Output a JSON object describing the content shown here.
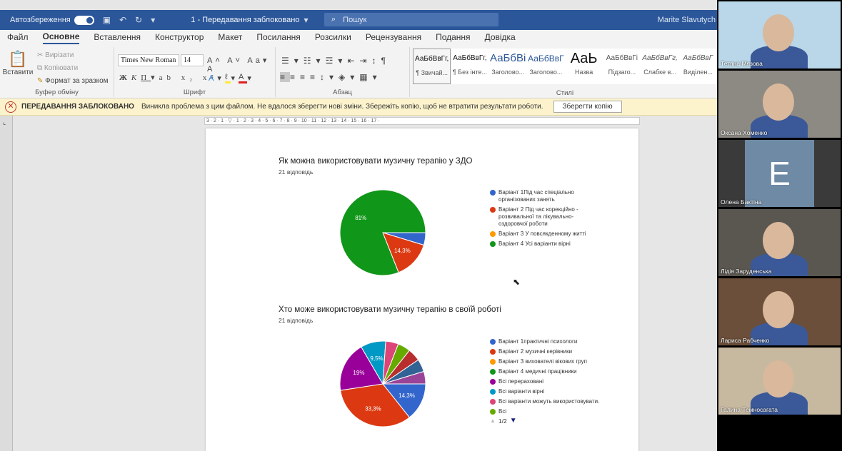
{
  "titlebar": {
    "autosave": "Автозбереження",
    "doc_title": "1 - Передавання заблоковано",
    "search_placeholder": "Пошук",
    "user": "Marite Slavutych"
  },
  "menu": [
    "Файл",
    "Основне",
    "Вставлення",
    "Конструктор",
    "Макет",
    "Посилання",
    "Розсилки",
    "Рецензування",
    "Подання",
    "Довідка"
  ],
  "ribbon": {
    "clipboard": {
      "paste": "Вставити",
      "cut": "Вирізати",
      "copy": "Копіювати",
      "format": "Формат за зразком",
      "label": "Буфер обміну"
    },
    "font": {
      "name": "Times New Roman",
      "size": "14",
      "label": "Шрифт"
    },
    "paragraph": {
      "label": "Абзац"
    },
    "styles": {
      "label": "Стилі",
      "items": [
        {
          "preview": "АаБбВвГг,",
          "name": "¶ Звичай..."
        },
        {
          "preview": "АаБбВвГг,",
          "name": "¶ Без інте..."
        },
        {
          "preview": "АаБбВі",
          "name": "Заголово..."
        },
        {
          "preview": "АаБбВвГ",
          "name": "Заголово..."
        },
        {
          "preview": "АаЬ",
          "name": "Назва"
        },
        {
          "preview": "АаБбВвГі",
          "name": "Підзаго..."
        },
        {
          "preview": "АаБбВвГг,",
          "name": "Слабке в..."
        },
        {
          "preview": "АаБбВвГ",
          "name": "Виділен..."
        }
      ]
    }
  },
  "banner": {
    "title": "ПЕРЕДАВАННЯ ЗАБЛОКОВАНО",
    "message": "Виникла проблема з цим файлом. Не вдалося зберегти нові зміни. Збережіть копію, щоб не втратити результати роботи.",
    "button": "Зберегти копію"
  },
  "chart_data": [
    {
      "type": "pie",
      "title": "Як можна використовувати музичну терапію у ЗДО",
      "subtitle": "21 відповідь",
      "labels": [
        "Варіант 1Під час спеціально організованих занять",
        "Варіант 2 Під час корекційно - розвивальної та лікувально-оздоровчої роботи",
        "Варіант 3 У повсякденному житті",
        "Варіант 4 Усі варіанти вірні"
      ],
      "values": [
        4.7,
        14.3,
        0,
        81
      ],
      "value_labels": [
        "",
        "14,3%",
        "",
        "81%"
      ],
      "colors": [
        "#3366cc",
        "#dc3912",
        "#ff9900",
        "#109618"
      ]
    },
    {
      "type": "pie",
      "title": "Хто може використовувати музичну терапію в своїй роботі",
      "subtitle": "21 відповідь",
      "labels": [
        "Варіант 1практичні психологи",
        "Варіант 2 музичні керівники",
        "Варіант 3 вихователі вікових груп",
        "Варіант 4 медичні працівники",
        "Всі перераховані",
        "Всі варіанти вірні",
        "Всі варіанти можуть використовувати.",
        "Всі"
      ],
      "values": [
        14.3,
        33.3,
        0,
        0,
        19,
        9.5,
        4.8,
        4.8,
        4.8,
        4.8
      ],
      "slice_colors": [
        "#3366cc",
        "#dc3912",
        "#990099",
        "#0099c6",
        "#dd4477",
        "#66aa00",
        "#b82e2e",
        "#316395",
        "#994499"
      ],
      "slice_values": [
        14.3,
        33.3,
        19,
        9.5,
        4.8,
        4.8,
        4.8,
        4.8,
        4.7
      ],
      "value_labels": [
        "14,3%",
        "33,3%",
        "19%",
        "9,5%",
        "",
        "",
        "",
        "",
        ""
      ],
      "legend_colors": [
        "#3366cc",
        "#dc3912",
        "#ff9900",
        "#109618",
        "#990099",
        "#0099c6",
        "#dd4477",
        "#66aa00"
      ],
      "pager": "1/2"
    }
  ],
  "participants": [
    {
      "name": "Тетяна Мязова",
      "bg": "#b9d7e8"
    },
    {
      "name": "Оксана Хоменко",
      "bg": "#8d8a84"
    },
    {
      "name": "Олена Бактіна",
      "initial": "E",
      "bg": "#6e8aa5"
    },
    {
      "name": "Лідія Заруденська",
      "bg": "#5a5650"
    },
    {
      "name": "Лариса Рабченко",
      "bg": "#6b4f3a"
    },
    {
      "name": "Галина Темносагата",
      "bg": "#c7b8a0"
    }
  ]
}
